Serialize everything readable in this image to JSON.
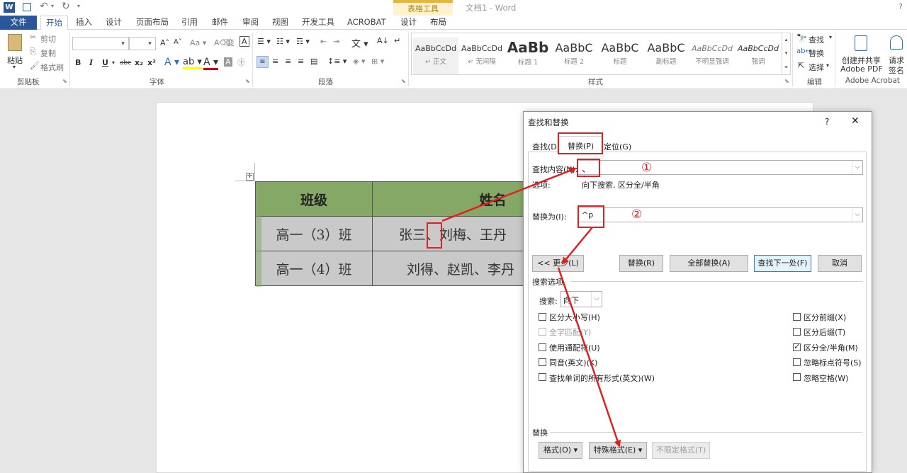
{
  "window": {
    "title": "文档1 - Word",
    "help_glyph": "?"
  },
  "context_tab": {
    "label": "表格工具",
    "tabs": [
      "设计",
      "布局"
    ]
  },
  "ribbon_tabs": [
    "文件",
    "开始",
    "插入",
    "设计",
    "页面布局",
    "引用",
    "邮件",
    "审阅",
    "视图",
    "开发工具",
    "ACROBAT"
  ],
  "clipboard": {
    "paste": "粘贴",
    "cut": "剪切",
    "copy": "复制",
    "format_painter": "格式刷",
    "group": "剪贴板"
  },
  "font": {
    "group": "字体",
    "bold": "B",
    "italic": "I",
    "underline": "U",
    "strike": "abc",
    "sub": "x₂",
    "sup": "x²"
  },
  "paragraph": {
    "group": "段落"
  },
  "styles": {
    "group": "样式",
    "items": [
      {
        "sample": "AaBbCcDd",
        "name": "↵ 正文"
      },
      {
        "sample": "AaBbCcDd",
        "name": "↵ 无间隔"
      },
      {
        "sample": "AaBb",
        "name": "标题 1"
      },
      {
        "sample": "AaBbC",
        "name": "标题 2"
      },
      {
        "sample": "AaBbC",
        "name": "标题"
      },
      {
        "sample": "AaBbC",
        "name": "副标题"
      },
      {
        "sample": "AaBbCcDd",
        "name": "不明显强调"
      },
      {
        "sample": "AaBbCcDd",
        "name": "强调"
      }
    ]
  },
  "editing": {
    "group": "编辑",
    "find": "查找",
    "replace": "替换",
    "select": "选择"
  },
  "acrobat": {
    "group": "Adobe Acrobat",
    "create_line1": "创建并共享",
    "create_line2": "Adobe PDF",
    "sign_line1": "请求",
    "sign_line2": "签名"
  },
  "table": {
    "headers": [
      "班级",
      "姓名"
    ],
    "rows": [
      [
        "高一（3）班",
        "张三、刘梅、王丹"
      ],
      [
        "高一（4）班",
        "刘得、赵凯、李丹"
      ]
    ]
  },
  "dialog": {
    "title": "查找和替换",
    "help": "?",
    "close": "✕",
    "tabs": [
      "查找(D)",
      "替换(P)",
      "定位(G)"
    ],
    "find_label": "查找内容(N):",
    "find_value": "、",
    "options_label": "选项:",
    "options_value": "向下搜索, 区分全/半角",
    "replace_label": "替换为(I):",
    "replace_value": "^p",
    "marker1": "①",
    "marker2": "②",
    "buttons": {
      "less": "<< 更少(L)",
      "replace": "替换(R)",
      "replace_all": "全部替换(A)",
      "find_next": "查找下一处(F)",
      "cancel": "取消"
    },
    "search_options_title": "搜索选项",
    "search_label": "搜索:",
    "search_value": "向下",
    "left_options": [
      {
        "label": "区分大小写(H)",
        "checked": false,
        "enabled": true
      },
      {
        "label": "全字匹配(Y)",
        "checked": false,
        "enabled": false
      },
      {
        "label": "使用通配符(U)",
        "checked": false,
        "enabled": true
      },
      {
        "label": "同音(英文)(K)",
        "checked": false,
        "enabled": true
      },
      {
        "label": "查找单词的所有形式(英文)(W)",
        "checked": false,
        "enabled": true
      }
    ],
    "right_options": [
      {
        "label": "区分前缀(X)",
        "checked": false
      },
      {
        "label": "区分后缀(T)",
        "checked": false
      },
      {
        "label": "区分全/半角(M)",
        "checked": true
      },
      {
        "label": "忽略标点符号(S)",
        "checked": false
      },
      {
        "label": "忽略空格(W)",
        "checked": false
      }
    ],
    "replace_section": "替换",
    "format_btn": "格式(O) ▾",
    "special_btn": "特殊格式(E) ▾",
    "no_format_btn": "不限定格式(T)"
  },
  "colors": {
    "accent": "#2b579a",
    "annotation": "#e02020",
    "table_header": "#86a866",
    "table_body": "#c9c9c9"
  }
}
